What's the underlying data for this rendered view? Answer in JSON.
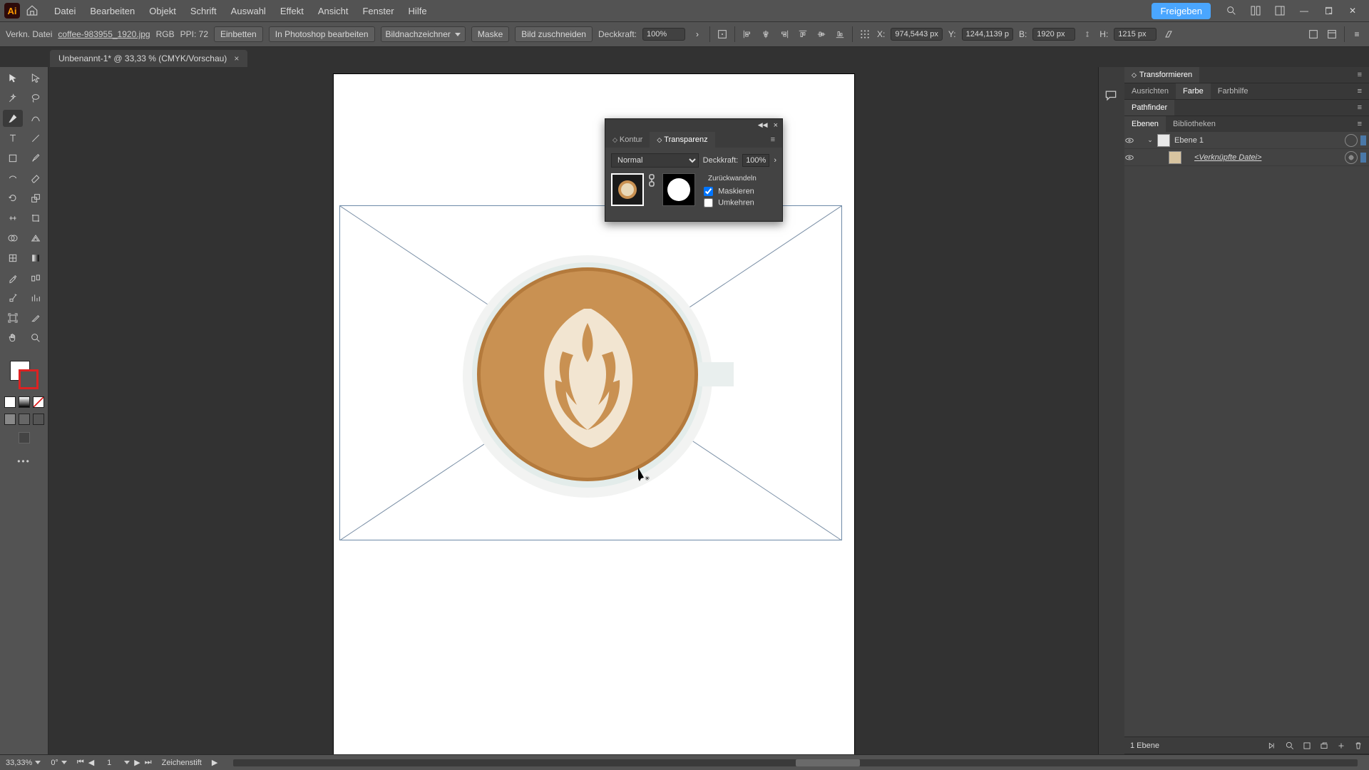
{
  "menubar": {
    "items": [
      "Datei",
      "Bearbeiten",
      "Objekt",
      "Schrift",
      "Auswahl",
      "Effekt",
      "Ansicht",
      "Fenster",
      "Hilfe"
    ],
    "share": "Freigeben"
  },
  "controlbar": {
    "context_label": "Verkn. Datei",
    "filename": "coffee-983955_1920.jpg",
    "color_mode": "RGB",
    "ppi_label": "PPI:",
    "ppi_value": "72",
    "embed": "Einbetten",
    "edit_ps": "In Photoshop bearbeiten",
    "image_trace": "Bildnachzeichner",
    "mask": "Maske",
    "crop": "Bild zuschneiden",
    "opacity_label": "Deckkraft:",
    "opacity_value": "100%",
    "x_label": "X:",
    "x_value": "974,5443 px",
    "y_label": "Y:",
    "y_value": "1244,1139 p",
    "w_label": "B:",
    "w_value": "1920 px",
    "h_label": "H:",
    "h_value": "1215 px"
  },
  "doctab": {
    "title": "Unbenannt-1* @ 33,33 % (CMYK/Vorschau)"
  },
  "transparency_panel": {
    "tabs": [
      "Kontur",
      "Transparenz"
    ],
    "blend_mode": "Normal",
    "opacity_label": "Deckkraft:",
    "opacity_value": "100%",
    "release": "Zurückwandeln",
    "mask_check": "Maskieren",
    "invert_check": "Umkehren",
    "mask_checked": true,
    "invert_checked": false
  },
  "right_panels": {
    "transform": "Transformieren",
    "align": "Ausrichten",
    "color": "Farbe",
    "color_help": "Farbhilfe",
    "pathfinder": "Pathfinder",
    "layers": "Ebenen",
    "libraries": "Bibliotheken",
    "layer_items": [
      {
        "name": "Ebene 1",
        "expandable": true
      },
      {
        "name": "<Verknüpfte Datei>",
        "sub": true
      }
    ],
    "layers_footer_count": "1 Ebene"
  },
  "statusbar": {
    "zoom": "33,33%",
    "rotate": "0°",
    "artboard_num": "1",
    "tool_hint": "Zeichenstift"
  }
}
